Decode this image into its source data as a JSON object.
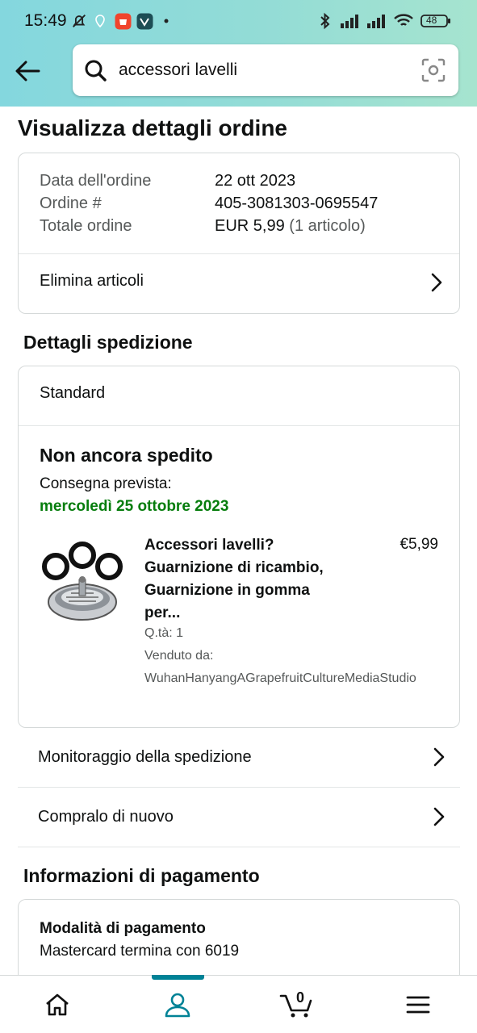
{
  "status_bar": {
    "time": "15:49",
    "battery": "48"
  },
  "search": {
    "query": "accessori lavelli"
  },
  "page_title": "Visualizza dettagli ordine",
  "order_summary": {
    "date_label": "Data dell'ordine",
    "date_value": "22 ott 2023",
    "number_label": "Ordine #",
    "number_value": "405-3081303-0695547",
    "total_label": "Totale ordine",
    "total_value": "EUR 5,99",
    "total_items": "(1 articolo)",
    "delete_items_label": "Elimina articoli"
  },
  "shipping": {
    "section_title": "Dettagli spedizione",
    "method": "Standard",
    "status": "Non ancora spedito",
    "delivery_label": "Consegna prevista:",
    "delivery_date": "mercoledì 25 ottobre 2023",
    "product": {
      "title": "Accessori lavelli? Guarnizione di ricambio, Guarnizione in gomma per...",
      "price": "€5,99",
      "qty": "Q.tà: 1",
      "sold_by_label": "Venduto da:",
      "seller": "WuhanHanyangAGrapefruitCultureMediaStudio"
    },
    "track_label": "Monitoraggio della spedizione",
    "buy_again_label": "Compralo di nuovo"
  },
  "payment": {
    "section_title": "Informazioni di pagamento",
    "method_title": "Modalità di pagamento",
    "method_value": "Mastercard  termina con 6019"
  },
  "bottom_nav": {
    "cart_count": "0",
    "items": [
      "home-icon",
      "account-icon",
      "cart-icon",
      "menu-icon"
    ],
    "active": "account-icon"
  },
  "colors": {
    "header_start": "#84d7de",
    "header_end": "#a6e4cf",
    "delivery_green": "#067d0d",
    "nav_accent": "#008296"
  }
}
